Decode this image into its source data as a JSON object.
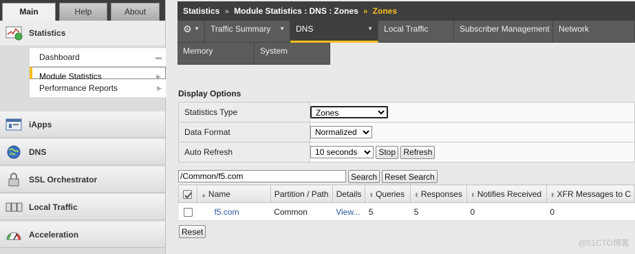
{
  "left_tabs": [
    "Main",
    "Help",
    "About"
  ],
  "left_nav": {
    "statistics": "Statistics",
    "submenu": [
      {
        "label": "Dashboard"
      },
      {
        "label": "Module Statistics"
      },
      {
        "label": "Performance Reports"
      }
    ],
    "modules": [
      "iApps",
      "DNS",
      "SSL Orchestrator",
      "Local Traffic",
      "Acceleration"
    ]
  },
  "breadcrumb": {
    "part1": "Statistics",
    "part2": "Module Statistics : DNS : Zones",
    "current": "Zones"
  },
  "tabs": [
    "Traffic Summary",
    "DNS",
    "Local Traffic",
    "Subscriber Management",
    "Network",
    "Memory",
    "System"
  ],
  "display_options": {
    "title": "Display Options",
    "statistics_type_label": "Statistics Type",
    "statistics_type_value": "Zones",
    "data_format_label": "Data Format",
    "data_format_value": "Normalized",
    "auto_refresh_label": "Auto Refresh",
    "auto_refresh_value": "10 seconds",
    "stop_button": "Stop",
    "refresh_button": "Refresh"
  },
  "search": {
    "value": "/Common/f5.com",
    "search_button": "Search",
    "reset_search_button": "Reset Search"
  },
  "table": {
    "headers": [
      "Name",
      "Partition / Path",
      "Details",
      "Queries",
      "Responses",
      "Notifies Received",
      "XFR Messages to C"
    ],
    "rows": [
      {
        "name": "f5.com",
        "partition": "Common",
        "details": "View...",
        "queries": "5",
        "responses": "5",
        "notifies": "0",
        "xfr": "0"
      }
    ]
  },
  "reset_button": "Reset",
  "watermark": "@51CTO博客"
}
